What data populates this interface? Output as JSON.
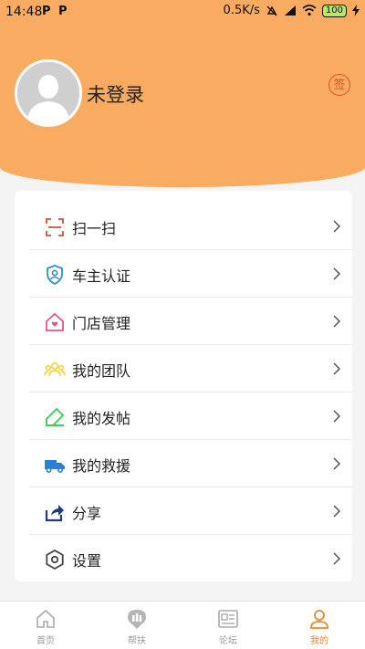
{
  "statusbar": {
    "time": "14:48",
    "app_icon_1": "P",
    "app_icon_2": "P",
    "speed": "0.5K/s",
    "battery": "100"
  },
  "profile": {
    "login_text": "未登录",
    "sign_label": "签"
  },
  "menu": [
    {
      "label": "扫一扫",
      "icon": "scan-icon",
      "color": "#c8553d"
    },
    {
      "label": "车主认证",
      "icon": "shield-user-icon",
      "color": "#2f8fd6"
    },
    {
      "label": "门店管理",
      "icon": "store-heart-icon",
      "color": "#e0578a"
    },
    {
      "label": "我的团队",
      "icon": "team-icon",
      "color": "#f2d545"
    },
    {
      "label": "我的发帖",
      "icon": "post-edit-icon",
      "color": "#3ccf52"
    },
    {
      "label": "我的救援",
      "icon": "truck-icon",
      "color": "#2b7fd8"
    },
    {
      "label": "分享",
      "icon": "share-icon",
      "color": "#1f3a7a"
    },
    {
      "label": "设置",
      "icon": "settings-icon",
      "color": "#444444"
    }
  ],
  "tabs": [
    {
      "label": "首页",
      "icon": "home-icon"
    },
    {
      "label": "帮扶",
      "icon": "help-icon"
    },
    {
      "label": "论坛",
      "icon": "forum-icon"
    },
    {
      "label": "我的",
      "icon": "profile-icon",
      "active": true
    }
  ],
  "colors": {
    "header": "#f9ab62",
    "accent": "#e48a26",
    "sign": "#e0502a"
  }
}
